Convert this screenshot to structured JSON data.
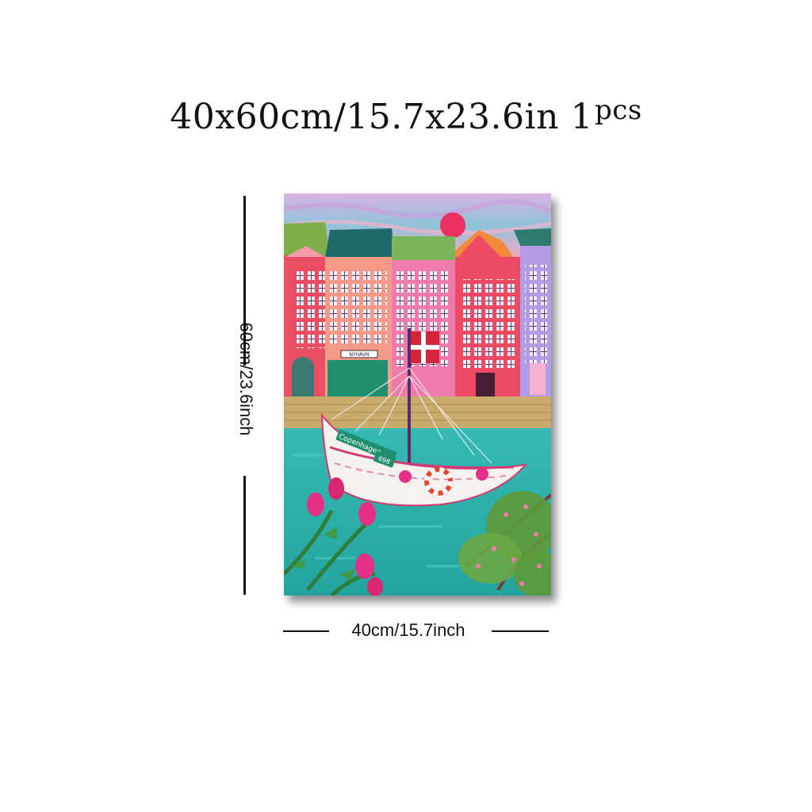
{
  "header": {
    "size_text": "40x60cm/15.7x23.6in",
    "count_text": "1",
    "count_unit": "pcs"
  },
  "dimensions": {
    "height_label": "60cm/23.6inch",
    "width_label": "40cm/15.7inch"
  },
  "artwork": {
    "boat_name": "Copenhagen",
    "boat_number": "698",
    "shop_sign": "NYHAVN"
  },
  "colors": {
    "sky": "#e7a3c8",
    "water": "#2fb8b0",
    "quay": "#c8ab6d",
    "accent_pink": "#e6336b",
    "flag_red": "#d4243b"
  }
}
